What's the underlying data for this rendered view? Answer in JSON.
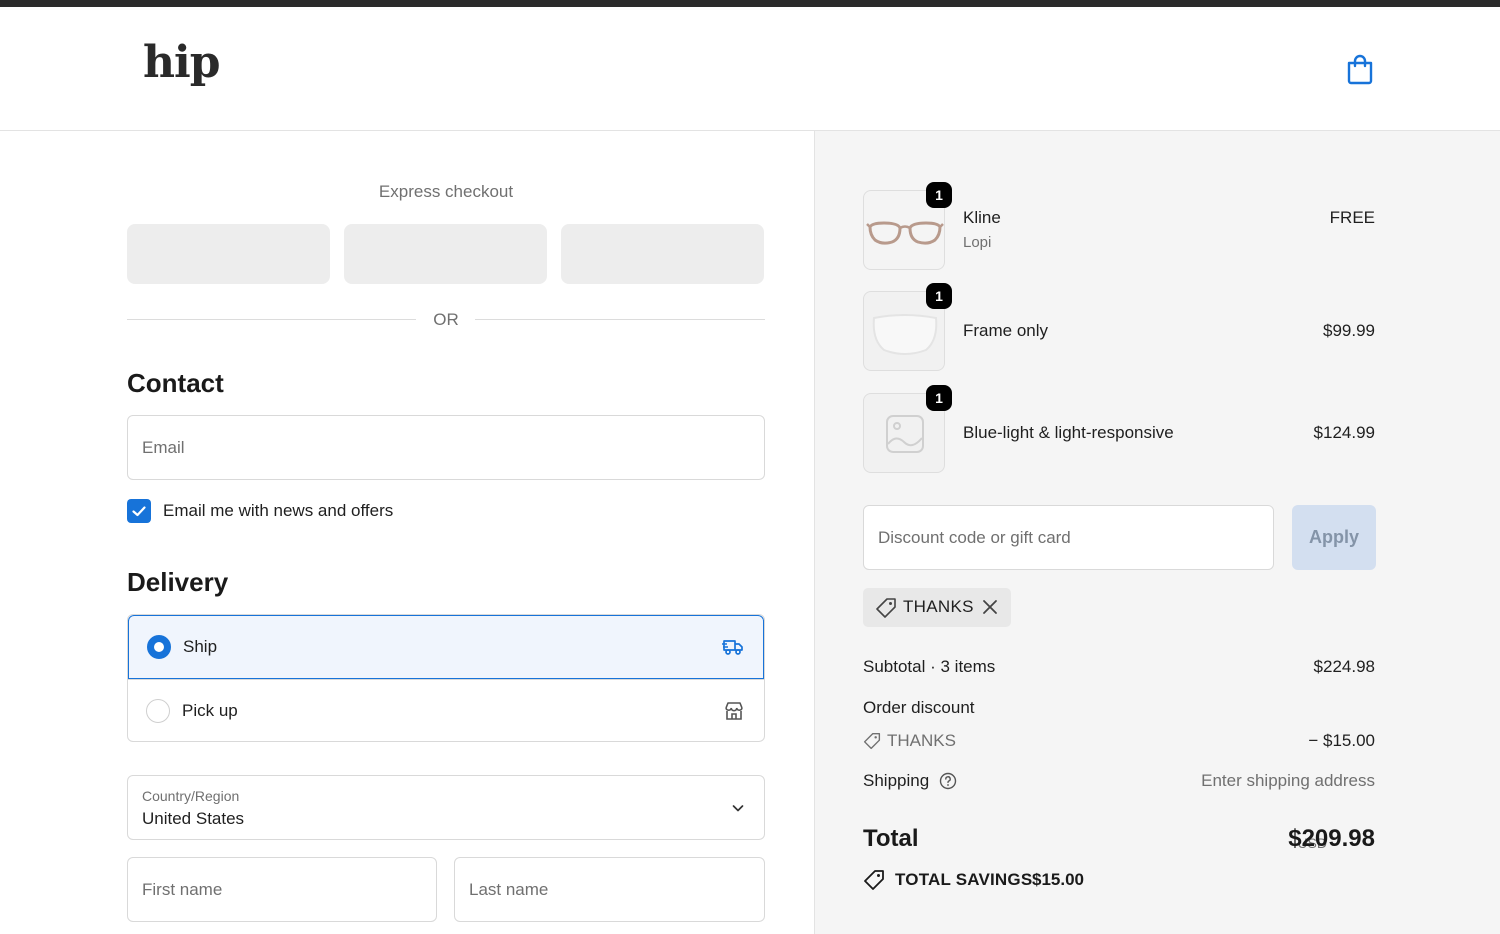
{
  "brand": {
    "logo_text": "hip"
  },
  "header": {
    "cart_icon": "shopping-bag-icon"
  },
  "express_checkout": {
    "label": "Express checkout",
    "or_label": "OR"
  },
  "contact": {
    "title": "Contact",
    "email_placeholder": "Email",
    "newsletter_label": "Email me with news and offers",
    "newsletter_checked": true
  },
  "delivery": {
    "title": "Delivery",
    "options": [
      {
        "label": "Ship",
        "selected": true,
        "icon": "truck-icon"
      },
      {
        "label": "Pick up",
        "selected": false,
        "icon": "store-icon"
      }
    ],
    "country_label": "Country/Region",
    "country_value": "United States",
    "first_name_placeholder": "First name",
    "last_name_placeholder": "Last name"
  },
  "order": {
    "items": [
      {
        "qty": "1",
        "name": "Kline",
        "variant": "Lopi",
        "price": "FREE"
      },
      {
        "qty": "1",
        "name": "Frame only",
        "price": "$99.99"
      },
      {
        "qty": "1",
        "name": "Blue-light & light-responsive",
        "price": "$124.99"
      }
    ],
    "discount_placeholder": "Discount code or gift card",
    "apply_label": "Apply",
    "applied_code": "THANKS",
    "subtotal_label": "Subtotal · 3 items",
    "subtotal_value": "$224.98",
    "order_discount_label": "Order discount",
    "discount_code": "THANKS",
    "discount_value": "− $15.00",
    "shipping_label": "Shipping",
    "shipping_value": "Enter shipping address",
    "total_label": "Total",
    "total_currency": "USD",
    "total_value": "$209.98",
    "savings_label": "TOTAL SAVINGS",
    "savings_value": "$15.00"
  },
  "colors": {
    "accent": "#1773d9",
    "sidebar_bg": "#f5f5f5",
    "apply_bg": "#d3dff0"
  }
}
